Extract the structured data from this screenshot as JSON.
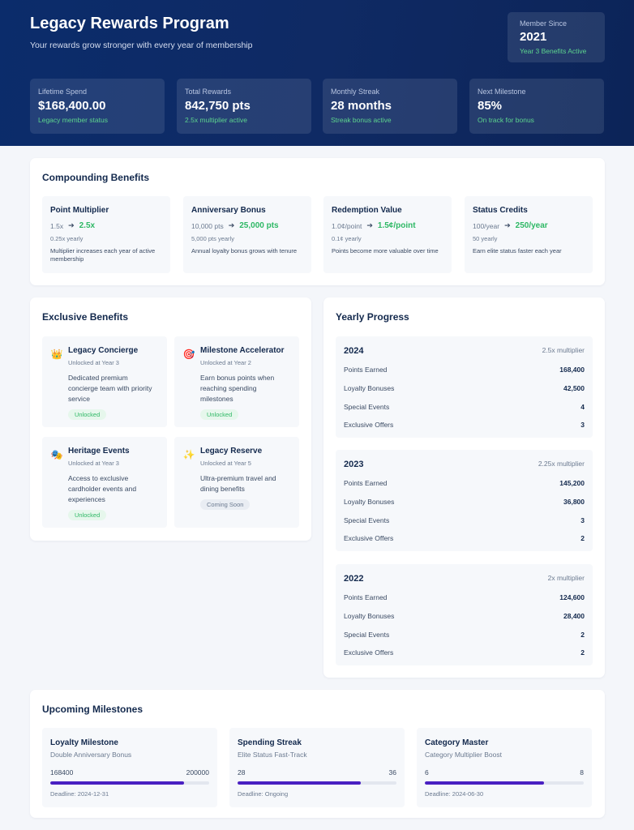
{
  "hero": {
    "title": "Legacy Rewards Program",
    "subtitle": "Your rewards grow stronger with every year of membership",
    "member": {
      "label": "Member Since",
      "year": "2021",
      "note": "Year 3 Benefits Active"
    },
    "stats": [
      {
        "label": "Lifetime Spend",
        "value": "$168,400.00",
        "note": "Legacy member status"
      },
      {
        "label": "Total Rewards",
        "value": "842,750 pts",
        "note": "2.5x multiplier active"
      },
      {
        "label": "Monthly Streak",
        "value": "28 months",
        "note": "Streak bonus active"
      },
      {
        "label": "Next Milestone",
        "value": "85%",
        "note": "On track for bonus"
      }
    ]
  },
  "compounding": {
    "title": "Compounding Benefits",
    "arrow": "➔",
    "items": [
      {
        "name": "Point Multiplier",
        "from": "1.5x",
        "to": "2.5x",
        "rate": "0.25x yearly",
        "desc": "Multiplier increases each year of active membership"
      },
      {
        "name": "Anniversary Bonus",
        "from": "10,000 pts",
        "to": "25,000 pts",
        "rate": "5,000 pts yearly",
        "desc": "Annual loyalty bonus grows with tenure"
      },
      {
        "name": "Redemption Value",
        "from": "1.0¢/point",
        "to": "1.5¢/point",
        "rate": "0.1¢ yearly",
        "desc": "Points become more valuable over time"
      },
      {
        "name": "Status Credits",
        "from": "100/year",
        "to": "250/year",
        "rate": "50 yearly",
        "desc": "Earn elite status faster each year"
      }
    ]
  },
  "exclusive": {
    "title": "Exclusive Benefits",
    "items": [
      {
        "icon": "crown-icon",
        "glyph": "👑",
        "name": "Legacy Concierge",
        "unlock": "Unlocked at Year 3",
        "desc": "Dedicated premium concierge team with priority service",
        "badge": "Unlocked"
      },
      {
        "icon": "target-icon",
        "glyph": "🎯",
        "name": "Milestone Accelerator",
        "unlock": "Unlocked at Year 2",
        "desc": "Earn bonus points when reaching spending milestones",
        "badge": "Unlocked"
      },
      {
        "icon": "masks-icon",
        "glyph": "🎭",
        "name": "Heritage Events",
        "unlock": "Unlocked at Year 3",
        "desc": "Access to exclusive cardholder events and experiences",
        "badge": "Unlocked"
      },
      {
        "icon": "sparkles-icon",
        "glyph": "✨",
        "name": "Legacy Reserve",
        "unlock": "Unlocked at Year 5",
        "desc": "Ultra-premium travel and dining benefits",
        "badge": "Coming Soon"
      }
    ]
  },
  "yearly": {
    "title": "Yearly Progress",
    "years": [
      {
        "year": "2024",
        "mult": "2.5x multiplier",
        "rows": [
          {
            "label": "Points Earned",
            "value": "168,400"
          },
          {
            "label": "Loyalty Bonuses",
            "value": "42,500"
          },
          {
            "label": "Special Events",
            "value": "4"
          },
          {
            "label": "Exclusive Offers",
            "value": "3"
          }
        ]
      },
      {
        "year": "2023",
        "mult": "2.25x multiplier",
        "rows": [
          {
            "label": "Points Earned",
            "value": "145,200"
          },
          {
            "label": "Loyalty Bonuses",
            "value": "36,800"
          },
          {
            "label": "Special Events",
            "value": "3"
          },
          {
            "label": "Exclusive Offers",
            "value": "2"
          }
        ]
      },
      {
        "year": "2022",
        "mult": "2x multiplier",
        "rows": [
          {
            "label": "Points Earned",
            "value": "124,600"
          },
          {
            "label": "Loyalty Bonuses",
            "value": "28,400"
          },
          {
            "label": "Special Events",
            "value": "2"
          },
          {
            "label": "Exclusive Offers",
            "value": "2"
          }
        ]
      }
    ]
  },
  "milestones": {
    "title": "Upcoming Milestones",
    "items": [
      {
        "name": "Loyalty Milestone",
        "sub": "Double Anniversary Bonus",
        "current": "168400",
        "target": "200000",
        "progress": 0.842,
        "deadline": "Deadline: 2024-12-31"
      },
      {
        "name": "Spending Streak",
        "sub": "Elite Status Fast-Track",
        "current": "28",
        "target": "36",
        "progress": 0.778,
        "deadline": "Deadline: Ongoing"
      },
      {
        "name": "Category Master",
        "sub": "Category Multiplier Boost",
        "current": "6",
        "target": "8",
        "progress": 0.75,
        "deadline": "Deadline: 2024-06-30"
      }
    ]
  },
  "colors": {
    "accent": "#4a20c2",
    "positive": "#2eb865",
    "hero": "#0b2c6b"
  }
}
